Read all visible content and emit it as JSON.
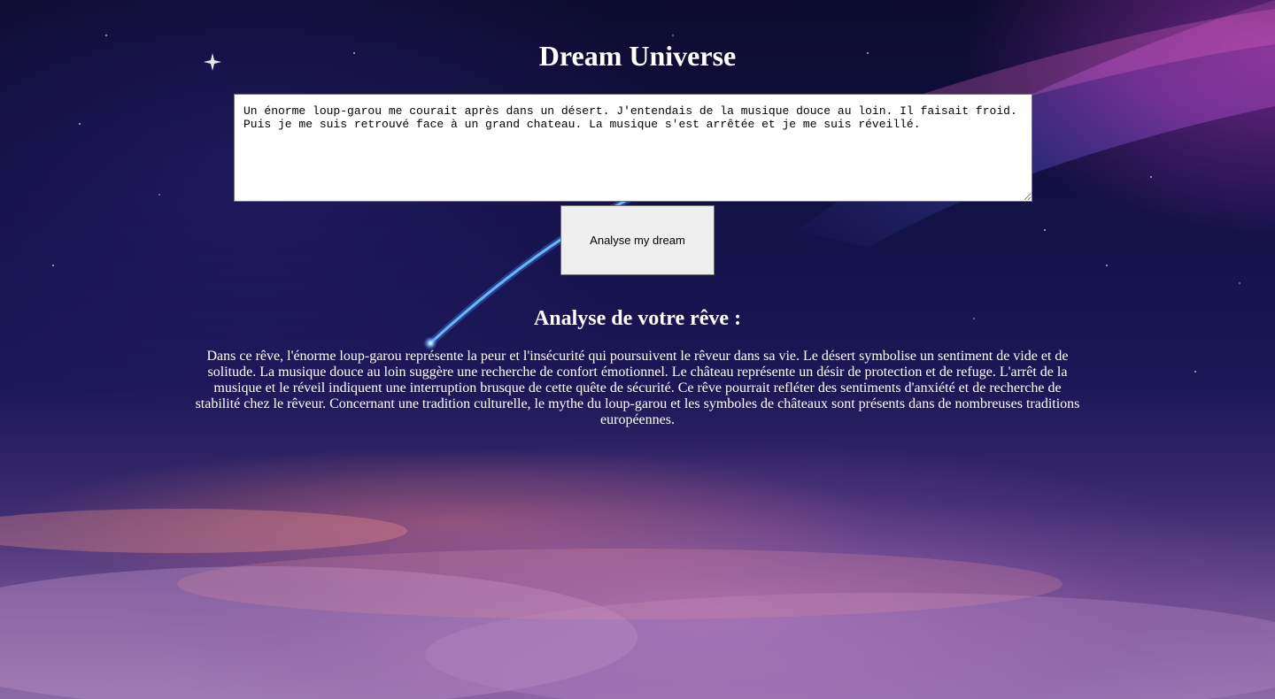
{
  "header": {
    "title": "Dream Universe"
  },
  "dream_form": {
    "textarea_value": "Un énorme loup-garou me courait après dans un désert. J'entendais de la musique douce au loin. Il faisait froid.\nPuis je me suis retrouvé face à un grand chateau. La musique s'est arrêtée et je me suis réveillé.",
    "submit_label": "Analyse my dream"
  },
  "analysis": {
    "heading": "Analyse de votre rêve :",
    "text": "Dans ce rêve, l'énorme loup-garou représente la peur et l'insécurité qui poursuivent le rêveur dans sa vie. Le désert symbolise un sentiment de vide et de solitude. La musique douce au loin suggère une recherche de confort émotionnel. Le château représente un désir de protection et de refuge. L'arrêt de la musique et le réveil indiquent une interruption brusque de cette quête de sécurité. Ce rêve pourrait refléter des sentiments d'anxiété et de recherche de stabilité chez le rêveur. Concernant une tradition culturelle, le mythe du loup-garou et les symboles de châteaux sont présents dans de nombreuses traditions européennes."
  },
  "colors": {
    "text": "#ffffff",
    "button_bg": "#efefef",
    "comet": "#7fd8ff"
  }
}
